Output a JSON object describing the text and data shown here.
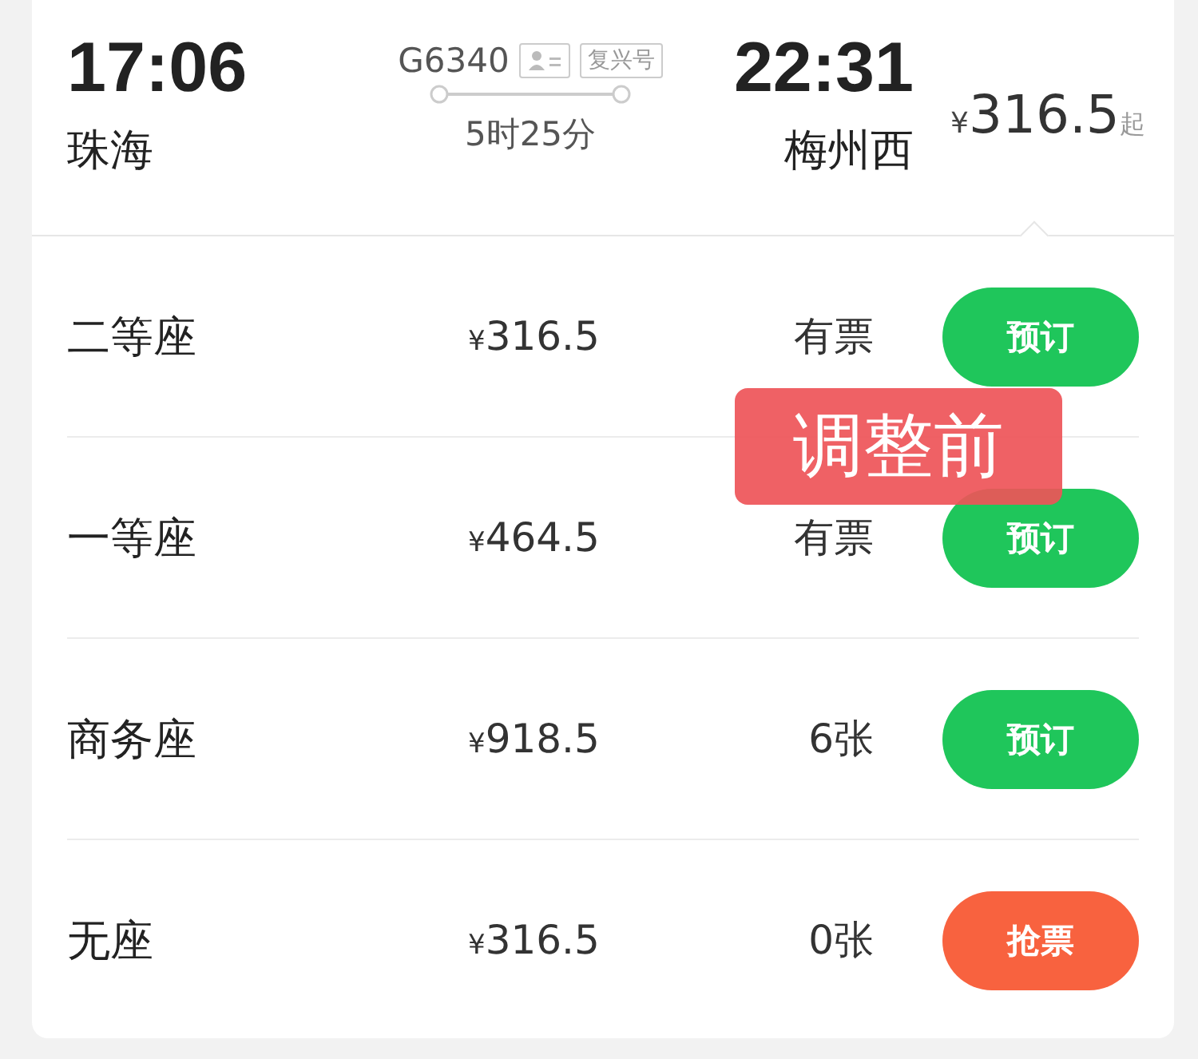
{
  "train": {
    "depart_time": "17:06",
    "depart_station": "珠海",
    "number": "G6340",
    "badge": "复兴号",
    "duration": "5时25分",
    "arrive_time": "22:31",
    "arrive_station": "梅州西",
    "price_symbol": "¥",
    "price": "316.5",
    "price_suffix": "起"
  },
  "seats": [
    {
      "class": "二等座",
      "price_symbol": "¥",
      "price": "316.5",
      "availability": "有票",
      "action": "预订",
      "kind": "book"
    },
    {
      "class": "一等座",
      "price_symbol": "¥",
      "price": "464.5",
      "availability": "有票",
      "action": "预订",
      "kind": "book"
    },
    {
      "class": "商务座",
      "price_symbol": "¥",
      "price": "918.5",
      "availability": "6张",
      "action": "预订",
      "kind": "book"
    },
    {
      "class": "无座",
      "price_symbol": "¥",
      "price": "316.5",
      "availability": "0张",
      "action": "抢票",
      "kind": "grab"
    }
  ],
  "annotation": {
    "text": "调整前"
  }
}
